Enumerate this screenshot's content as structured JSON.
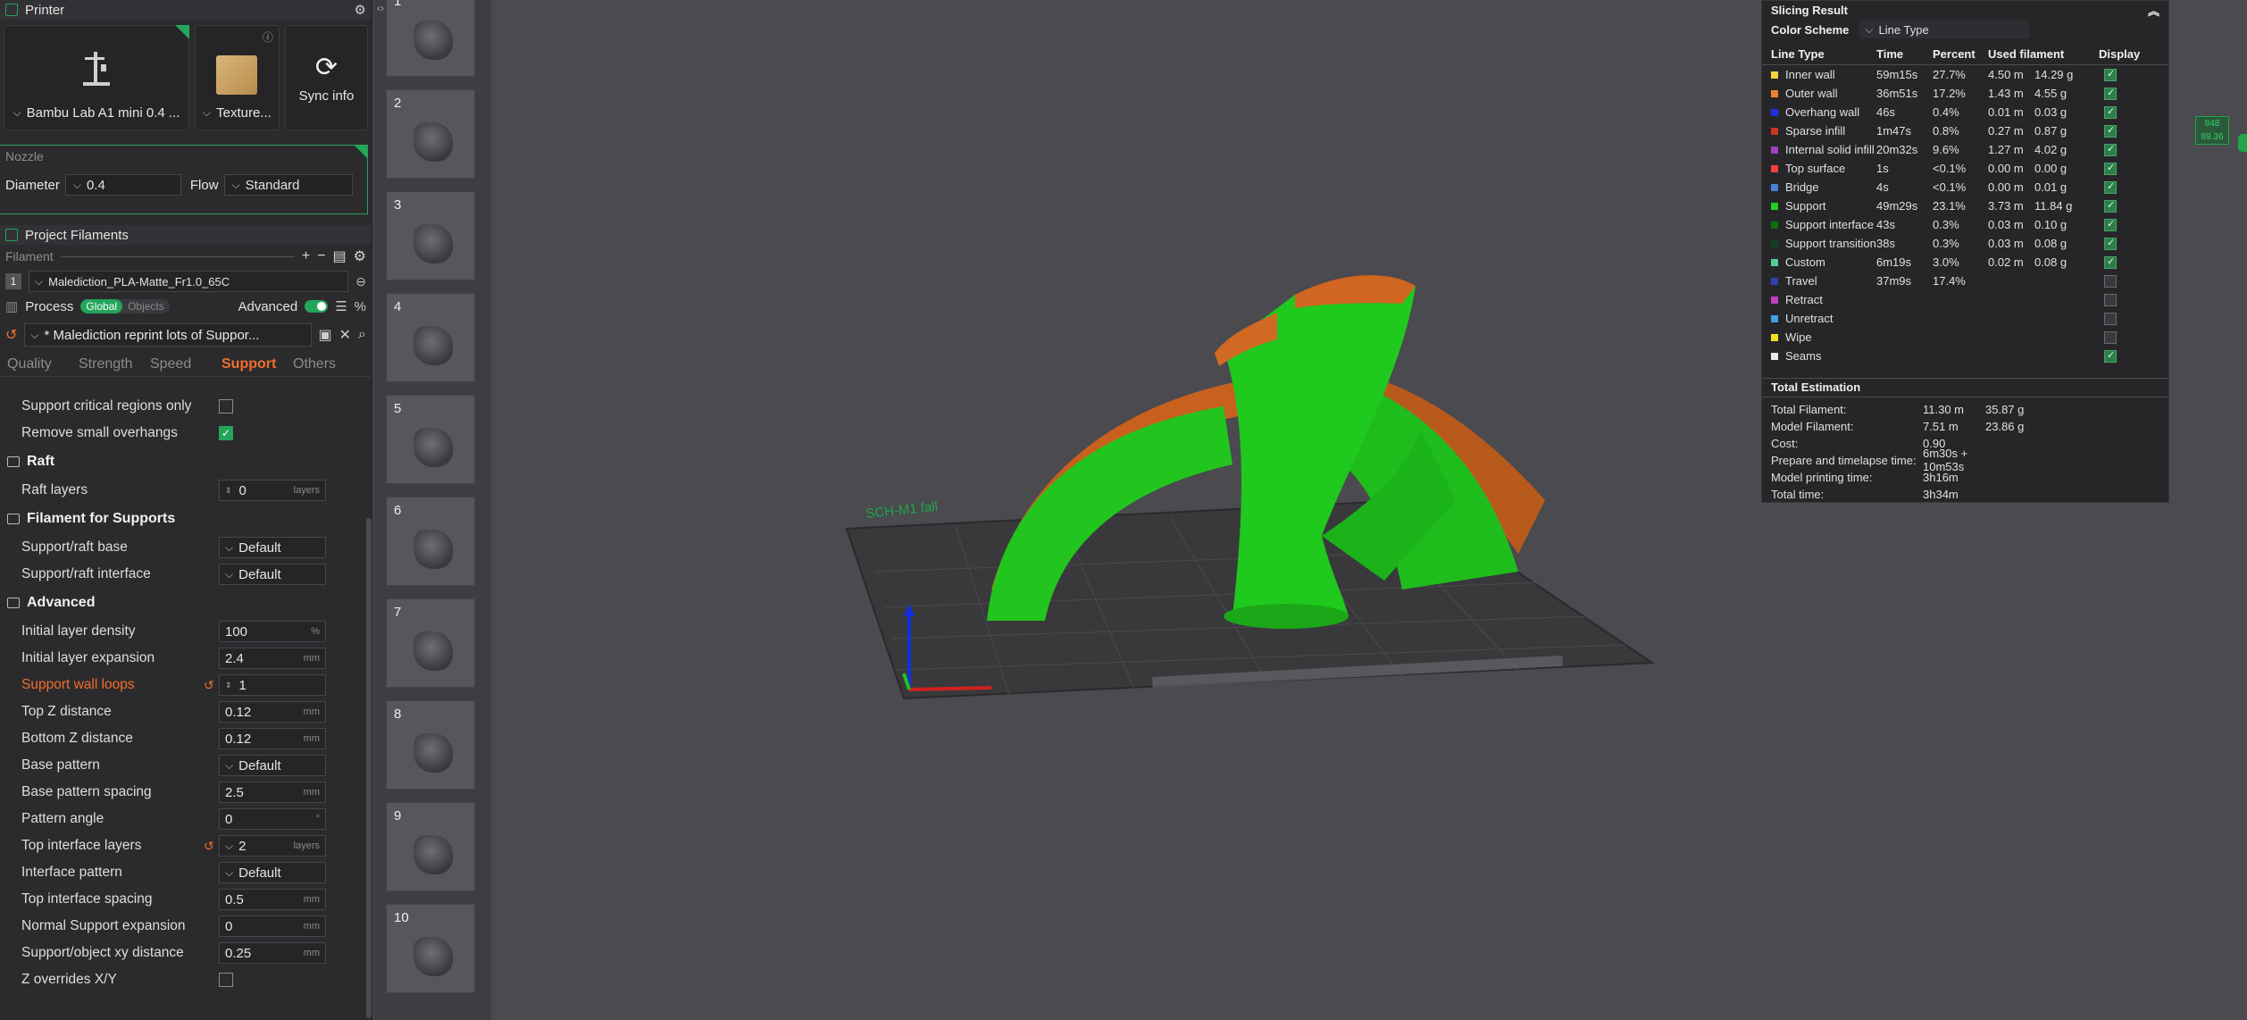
{
  "printer": {
    "title": "Printer",
    "machine": "Bambu Lab A1 mini 0.4 ...",
    "plate": "Texture...",
    "sync": "Sync info",
    "nozzle_label": "Nozzle",
    "diameter_label": "Diameter",
    "diameter": "0.4",
    "flow_label": "Flow",
    "flow": "Standard"
  },
  "filaments": {
    "title": "Project Filaments",
    "header": "Filament",
    "items": [
      {
        "num": "1",
        "name": "Malediction_PLA-Matte_Fr1.0_65C"
      }
    ]
  },
  "process": {
    "title": "Process",
    "scope_global": "Global",
    "scope_objects": "Objects",
    "advanced_label": "Advanced",
    "preset": "* Malediction reprint lots of Suppor...",
    "tabs": [
      "Quality",
      "Strength",
      "Speed",
      "Support",
      "Others"
    ],
    "active_tab": "Support"
  },
  "settings": {
    "support_critical": "Support critical regions only",
    "remove_small": "Remove small overhangs",
    "raft_group": "Raft",
    "raft_layers": "Raft layers",
    "raft_layers_val": "0",
    "raft_layers_unit": "layers",
    "fil_group": "Filament for Supports",
    "raft_base": "Support/raft base",
    "raft_base_val": "Default",
    "raft_iface": "Support/raft interface",
    "raft_iface_val": "Default",
    "adv_group": "Advanced",
    "rows": [
      {
        "name": "Initial layer density",
        "val": "100",
        "unit": "%"
      },
      {
        "name": "Initial layer expansion",
        "val": "2.4",
        "unit": "mm"
      },
      {
        "name": "Support wall loops",
        "val": "1",
        "unit": ""
      },
      {
        "name": "Top Z distance",
        "val": "0.12",
        "unit": "mm"
      },
      {
        "name": "Bottom Z distance",
        "val": "0.12",
        "unit": "mm"
      },
      {
        "name": "Base pattern",
        "val": "Default",
        "unit": ""
      },
      {
        "name": "Base pattern spacing",
        "val": "2.5",
        "unit": "mm"
      },
      {
        "name": "Pattern angle",
        "val": "0",
        "unit": "°"
      },
      {
        "name": "Top interface layers",
        "val": "2",
        "unit": "layers"
      },
      {
        "name": "Interface pattern",
        "val": "Default",
        "unit": ""
      },
      {
        "name": "Top interface spacing",
        "val": "0.5",
        "unit": "mm"
      },
      {
        "name": "Normal Support expansion",
        "val": "0",
        "unit": "mm"
      },
      {
        "name": "Support/object xy distance",
        "val": "0.25",
        "unit": "mm"
      },
      {
        "name": "Z overrides X/Y",
        "val": "",
        "unit": ""
      }
    ]
  },
  "thumbnails": [
    "1",
    "2",
    "3",
    "4",
    "5",
    "6",
    "7",
    "8",
    "9",
    "10"
  ],
  "viewport": {
    "bed_text": "SCH-M1 fall"
  },
  "result": {
    "title": "Slicing Result",
    "scheme_label": "Color Scheme",
    "scheme": "Line Type",
    "headers": [
      "Line Type",
      "Time",
      "Percent",
      "Used filament",
      "Display"
    ],
    "rows": [
      {
        "name": "Inner wall",
        "color": "#f5d33a",
        "time": "59m15s",
        "pct": "27.7%",
        "m": "4.50 m",
        "g": "14.29 g",
        "on": true
      },
      {
        "name": "Outer wall",
        "color": "#f08030",
        "time": "36m51s",
        "pct": "17.2%",
        "m": "1.43 m",
        "g": "4.55 g",
        "on": true
      },
      {
        "name": "Overhang wall",
        "color": "#2030e0",
        "time": "46s",
        "pct": "0.4%",
        "m": "0.01 m",
        "g": "0.03 g",
        "on": true
      },
      {
        "name": "Sparse infill",
        "color": "#c8381e",
        "time": "1m47s",
        "pct": "0.8%",
        "m": "0.27 m",
        "g": "0.87 g",
        "on": true
      },
      {
        "name": "Internal solid infill",
        "color": "#a040c0",
        "time": "20m32s",
        "pct": "9.6%",
        "m": "1.27 m",
        "g": "4.02 g",
        "on": true
      },
      {
        "name": "Top surface",
        "color": "#f04040",
        "time": "1s",
        "pct": "<0.1%",
        "m": "0.00 m",
        "g": "0.00 g",
        "on": true
      },
      {
        "name": "Bridge",
        "color": "#4a80d0",
        "time": "4s",
        "pct": "<0.1%",
        "m": "0.00 m",
        "g": "0.01 g",
        "on": true
      },
      {
        "name": "Support",
        "color": "#20d020",
        "time": "49m29s",
        "pct": "23.1%",
        "m": "3.73 m",
        "g": "11.84 g",
        "on": true
      },
      {
        "name": "Support interface",
        "color": "#107010",
        "time": "43s",
        "pct": "0.3%",
        "m": "0.03 m",
        "g": "0.10 g",
        "on": true
      },
      {
        "name": "Support transition",
        "color": "#104020",
        "time": "38s",
        "pct": "0.3%",
        "m": "0.03 m",
        "g": "0.08 g",
        "on": true
      },
      {
        "name": "Custom",
        "color": "#50d090",
        "time": "6m19s",
        "pct": "3.0%",
        "m": "0.02 m",
        "g": "0.08 g",
        "on": true
      },
      {
        "name": "Travel",
        "color": "#3040b0",
        "time": "37m9s",
        "pct": "17.4%",
        "m": "",
        "g": "",
        "on": false
      },
      {
        "name": "Retract",
        "color": "#c040c0",
        "time": "",
        "pct": "",
        "m": "",
        "g": "",
        "on": false
      },
      {
        "name": "Unretract",
        "color": "#40a0e0",
        "time": "",
        "pct": "",
        "m": "",
        "g": "",
        "on": false
      },
      {
        "name": "Wipe",
        "color": "#f0e020",
        "time": "",
        "pct": "",
        "m": "",
        "g": "",
        "on": false
      },
      {
        "name": "Seams",
        "color": "#e8e8e8",
        "time": "",
        "pct": "",
        "m": "",
        "g": "",
        "on": true
      }
    ],
    "total_title": "Total Estimation",
    "totals": [
      {
        "k": "Total Filament:",
        "v1": "11.30 m",
        "v2": "35.87 g"
      },
      {
        "k": "Model Filament:",
        "v1": "7.51 m",
        "v2": "23.86 g"
      },
      {
        "k": "Cost:",
        "v1": "0.90",
        "v2": ""
      },
      {
        "k": "Prepare and timelapse time:",
        "v1": "6m30s + 10m53s",
        "v2": ""
      },
      {
        "k": "Model printing time:",
        "v1": "3h16m",
        "v2": ""
      },
      {
        "k": "Total time:",
        "v1": "3h34m",
        "v2": ""
      }
    ]
  },
  "layer": {
    "top": "848",
    "height": "89.36"
  }
}
